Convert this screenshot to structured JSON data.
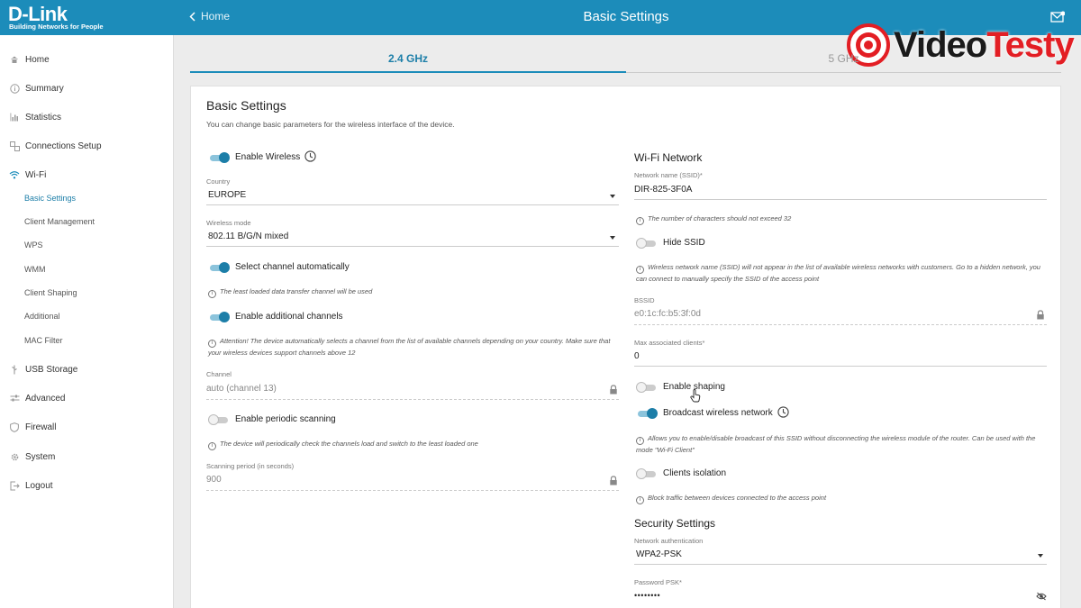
{
  "brand": {
    "name": "D-Link",
    "tagline": "Building Networks for People"
  },
  "header": {
    "back_label": "Home",
    "title": "Basic Settings"
  },
  "watermark": {
    "prefix": "Video",
    "suffix": "Testy"
  },
  "sidebar": {
    "items": [
      {
        "label": "Home",
        "icon": "home-icon"
      },
      {
        "label": "Summary",
        "icon": "info-icon"
      },
      {
        "label": "Statistics",
        "icon": "bar-chart-icon"
      },
      {
        "label": "Connections Setup",
        "icon": "connections-icon"
      },
      {
        "label": "Wi-Fi",
        "icon": "wifi-icon"
      },
      {
        "label": "USB Storage",
        "icon": "usb-icon"
      },
      {
        "label": "Advanced",
        "icon": "sliders-icon"
      },
      {
        "label": "Firewall",
        "icon": "shield-icon"
      },
      {
        "label": "System",
        "icon": "gear-icon"
      },
      {
        "label": "Logout",
        "icon": "logout-icon"
      }
    ],
    "wifi_sub": [
      "Basic Settings",
      "Client Management",
      "WPS",
      "WMM",
      "Client Shaping",
      "Additional",
      "MAC Filter"
    ]
  },
  "tabs": {
    "band24": "2.4 GHz",
    "band5": "5 GHz"
  },
  "card": {
    "title": "Basic Settings",
    "description": "You can change basic parameters for the wireless interface of the device.",
    "left": {
      "enable_wireless": "Enable Wireless",
      "country_label": "Country",
      "country_value": "EUROPE",
      "mode_label": "Wireless mode",
      "mode_value": "802.11 B/G/N mixed",
      "auto_channel": "Select channel automatically",
      "auto_channel_hint": "The least loaded data transfer channel will be used",
      "additional_channels": "Enable additional channels",
      "additional_hint_1": "Attention! The device automatically selects a channel from the list of available channels depending on your country. Make sure that",
      "additional_hint_2": "your wireless devices support channels above 12",
      "channel_label": "Channel",
      "channel_value": "auto (channel 13)",
      "periodic_scanning": "Enable periodic scanning",
      "periodic_hint": "The device will periodically check the channels load and switch to the least loaded one",
      "scan_period_label": "Scanning period (in seconds)",
      "scan_period_value": "900"
    },
    "right": {
      "section_wifi": "Wi-Fi Network",
      "ssid_label": "Network name (SSID)*",
      "ssid_value": "DIR-825-3F0A",
      "ssid_hint": "The number of characters should not exceed 32",
      "hide_ssid": "Hide SSID",
      "hide_hint_1": "Wireless network name (SSID) will not appear in the list of available wireless networks with customers. Go to a hidden network, you",
      "hide_hint_2": "can connect to manually specify the SSID of the access point",
      "bssid_label": "BSSID",
      "bssid_value": "e0:1c:fc:b5:3f:0d",
      "max_clients_label": "Max associated clients*",
      "max_clients_value": "0",
      "enable_shaping": "Enable shaping",
      "broadcast": "Broadcast wireless network",
      "broadcast_hint_1": "Allows you to enable/disable broadcast of this SSID without disconnecting the wireless module of the router. Can be used with the",
      "broadcast_hint_2": "mode \"Wi-Fi Client\"",
      "isolation": "Clients isolation",
      "isolation_hint": "Block traffic between devices connected to the access point",
      "section_security": "Security Settings",
      "auth_label": "Network authentication",
      "auth_value": "WPA2-PSK",
      "psk_label": "Password PSK*",
      "psk_value": "••••••••"
    }
  },
  "toggles": {
    "enable_wireless": true,
    "auto_channel": true,
    "additional_channels": true,
    "periodic_scanning": false,
    "hide_ssid": false,
    "enable_shaping": false,
    "broadcast": true,
    "isolation": false
  },
  "colors": {
    "accent": "#1c8cba",
    "toggle_on": "#1c7ea8"
  }
}
